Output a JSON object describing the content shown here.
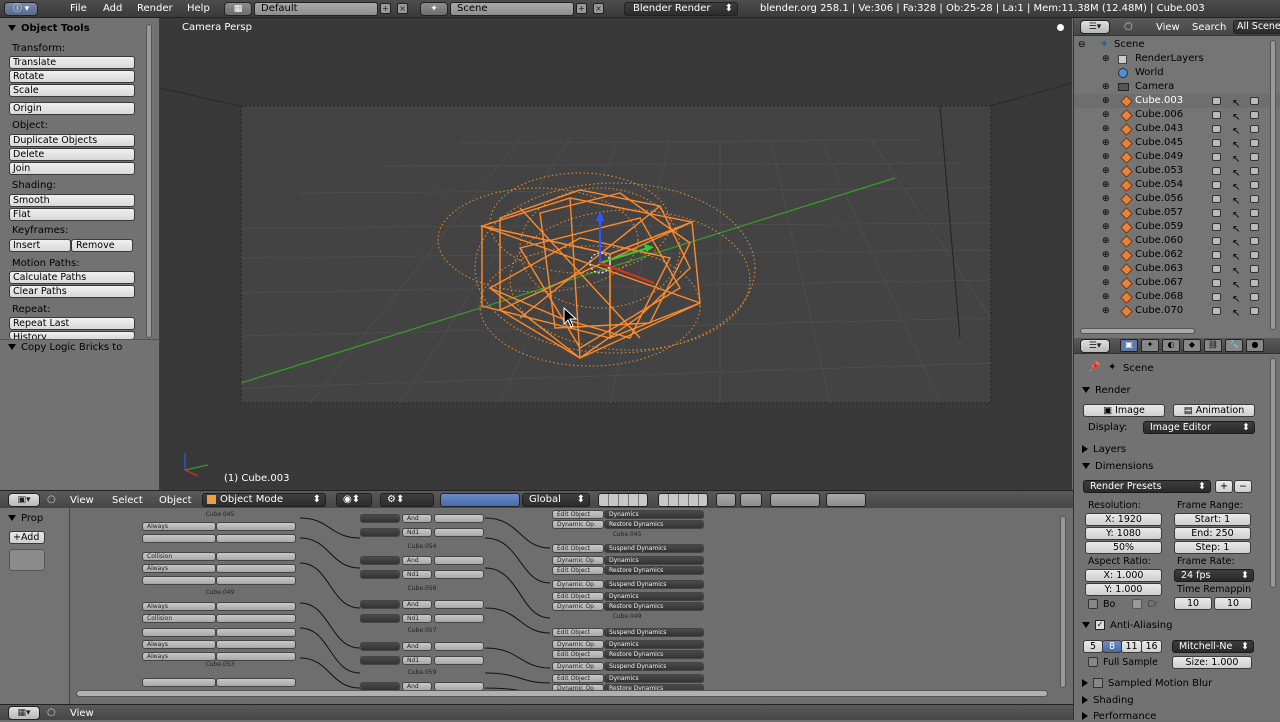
{
  "topbar": {
    "menus": [
      "File",
      "Add",
      "Render",
      "Help"
    ],
    "screen_layout": "Default",
    "scene": "Scene",
    "render_engine": "Blender Render",
    "stats": "blender.org 258.1 | Ve:306 | Fa:328 | Ob:25-28 | La:1 | Mem:11.38M (12.48M) | Cube.003"
  },
  "tool_panel": {
    "title": "Object Tools",
    "transform_label": "Transform:",
    "translate": "Translate",
    "rotate": "Rotate",
    "scale": "Scale",
    "origin": "Origin",
    "object_label": "Object:",
    "duplicate": "Duplicate Objects",
    "delete": "Delete",
    "join": "Join",
    "shading_label": "Shading:",
    "smooth": "Smooth",
    "flat": "Flat",
    "keyframes_label": "Keyframes:",
    "insert": "Insert",
    "remove": "Remove",
    "motion_paths_label": "Motion Paths:",
    "calc_paths": "Calculate Paths",
    "clear_paths": "Clear Paths",
    "repeat_label": "Repeat:",
    "repeat_last": "Repeat Last",
    "history": "History",
    "copy_logic": "Copy Logic Bricks to"
  },
  "viewport": {
    "view_name": "Camera Persp",
    "object_label": "(1) Cube.003"
  },
  "viewport_header": {
    "view": "View",
    "select": "Select",
    "object": "Object",
    "mode": "Object Mode",
    "orientation": "Global"
  },
  "outliner": {
    "view": "View",
    "search": "Search",
    "filter": "All Scene",
    "scene": "Scene",
    "render_layers": "RenderLayers",
    "world": "World",
    "camera": "Camera",
    "objects": [
      "Cube.003",
      "Cube.006",
      "Cube.043",
      "Cube.045",
      "Cube.049",
      "Cube.053",
      "Cube.054",
      "Cube.056",
      "Cube.057",
      "Cube.059",
      "Cube.060",
      "Cube.062",
      "Cube.063",
      "Cube.067",
      "Cube.068",
      "Cube.070"
    ]
  },
  "properties": {
    "scene": "Scene",
    "render": "Render",
    "image": "Image",
    "animation": "Animation",
    "display_label": "Display:",
    "display_value": "Image Editor",
    "layers": "Layers",
    "dimensions": "Dimensions",
    "render_presets": "Render Presets",
    "resolution_label": "Resolution:",
    "res_x": "X: 1920",
    "res_y": "Y: 1080",
    "res_pct": "50%",
    "frame_range_label": "Frame Range:",
    "start": "Start: 1",
    "end": "End: 250",
    "step": "Step: 1",
    "aspect_label": "Aspect Ratio:",
    "aspect_x": "X: 1.000",
    "aspect_y": "Y: 1.000",
    "frame_rate_label": "Frame Rate:",
    "fps": "24 fps",
    "time_remap_label": "Time Remappin",
    "remap_old": "10",
    "remap_new": "10",
    "border": "Bo",
    "crop": "Cr",
    "anti_aliasing": "Anti-Aliasing",
    "aa_samples": [
      "5",
      "8",
      "11",
      "16"
    ],
    "filter": "Mitchell-Ne",
    "full_sample": "Full Sample",
    "size": "Size: 1.000",
    "motion_blur": "Sampled Motion Blur",
    "shading": "Shading",
    "performance": "Performance"
  },
  "logic_editor": {
    "prop": "Prop",
    "add": "Add",
    "view": "View",
    "objects": [
      "Cube.045",
      "Cube.049",
      "Cube.053"
    ],
    "controller_objects": [
      "Cube.054",
      "Cube.056",
      "Cube.057",
      "Cube.059"
    ],
    "actuator_objects": [
      "Cube.045",
      "Cube.049"
    ],
    "sensor_types": [
      "Always",
      "Collision"
    ],
    "controller_types": [
      "And",
      "Nd1"
    ],
    "actuator_labels": [
      "Edit Object",
      "Dynamic Op",
      "Dynamics",
      "Restore Dynamics",
      "Suspend Dynamics"
    ]
  },
  "colors": {
    "selection_orange": "#ff8a2a",
    "x_axis": "#3a9a2a",
    "y_axis": "#3a9a2a",
    "viewport_bg": "#393939",
    "panel_bg": "#727272"
  }
}
